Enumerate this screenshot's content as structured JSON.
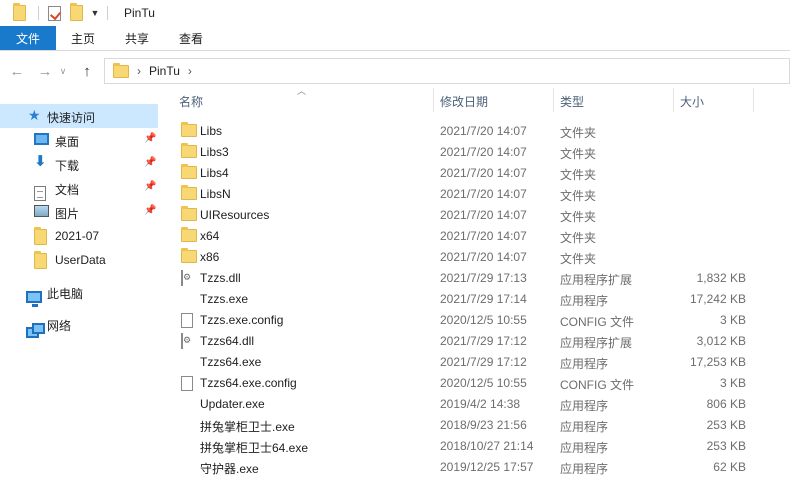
{
  "window": {
    "title": "PinTu"
  },
  "ribbon": {
    "tabs": [
      "文件",
      "主页",
      "共享",
      "查看"
    ]
  },
  "address": {
    "path": "PinTu"
  },
  "nav": {
    "quick_access": "快速访问",
    "items": [
      {
        "label": "桌面",
        "icon": "desktop-icon",
        "pinned": true
      },
      {
        "label": "下载",
        "icon": "download-icon",
        "pinned": true
      },
      {
        "label": "文档",
        "icon": "document-icon",
        "pinned": true
      },
      {
        "label": "图片",
        "icon": "pictures-icon",
        "pinned": true
      },
      {
        "label": "2021-07",
        "icon": "folder-icon",
        "pinned": false
      },
      {
        "label": "UserData",
        "icon": "folder-icon",
        "pinned": false
      }
    ],
    "this_pc": "此电脑",
    "network": "网络"
  },
  "columns": {
    "name": "名称",
    "date": "修改日期",
    "type": "类型",
    "size": "大小"
  },
  "files": [
    {
      "name": "Libs",
      "date": "2021/7/20 14:07",
      "type": "文件夹",
      "size": "",
      "icon": "folder-icon"
    },
    {
      "name": "Libs3",
      "date": "2021/7/20 14:07",
      "type": "文件夹",
      "size": "",
      "icon": "folder-icon"
    },
    {
      "name": "Libs4",
      "date": "2021/7/20 14:07",
      "type": "文件夹",
      "size": "",
      "icon": "folder-icon"
    },
    {
      "name": "LibsN",
      "date": "2021/7/20 14:07",
      "type": "文件夹",
      "size": "",
      "icon": "folder-icon"
    },
    {
      "name": "UIResources",
      "date": "2021/7/20 14:07",
      "type": "文件夹",
      "size": "",
      "icon": "folder-icon"
    },
    {
      "name": "x64",
      "date": "2021/7/20 14:07",
      "type": "文件夹",
      "size": "",
      "icon": "folder-icon"
    },
    {
      "name": "x86",
      "date": "2021/7/20 14:07",
      "type": "文件夹",
      "size": "",
      "icon": "folder-icon"
    },
    {
      "name": "Tzzs.dll",
      "date": "2021/7/29 17:13",
      "type": "应用程序扩展",
      "size": "1,832 KB",
      "icon": "dll-file-icon"
    },
    {
      "name": "Tzzs.exe",
      "date": "2021/7/29 17:14",
      "type": "应用程序",
      "size": "17,242 KB",
      "icon": "app-icon"
    },
    {
      "name": "Tzzs.exe.config",
      "date": "2020/12/5 10:55",
      "type": "CONFIG 文件",
      "size": "3 KB",
      "icon": "config-file-icon"
    },
    {
      "name": "Tzzs64.dll",
      "date": "2021/7/29 17:12",
      "type": "应用程序扩展",
      "size": "3,012 KB",
      "icon": "dll-file-icon"
    },
    {
      "name": "Tzzs64.exe",
      "date": "2021/7/29 17:12",
      "type": "应用程序",
      "size": "17,253 KB",
      "icon": "app-icon"
    },
    {
      "name": "Tzzs64.exe.config",
      "date": "2020/12/5 10:55",
      "type": "CONFIG 文件",
      "size": "3 KB",
      "icon": "config-file-icon"
    },
    {
      "name": "Updater.exe",
      "date": "2019/4/2 14:38",
      "type": "应用程序",
      "size": "806 KB",
      "icon": "updater-app-icon"
    },
    {
      "name": "拼兔掌柜卫士.exe",
      "date": "2018/9/23 21:56",
      "type": "应用程序",
      "size": "253 KB",
      "icon": "app-icon"
    },
    {
      "name": "拼兔掌柜卫士64.exe",
      "date": "2018/10/27 21:14",
      "type": "应用程序",
      "size": "253 KB",
      "icon": "app-icon"
    },
    {
      "name": "守护器.exe",
      "date": "2019/12/25 17:57",
      "type": "应用程序",
      "size": "62 KB",
      "icon": "shield-app-icon"
    }
  ]
}
